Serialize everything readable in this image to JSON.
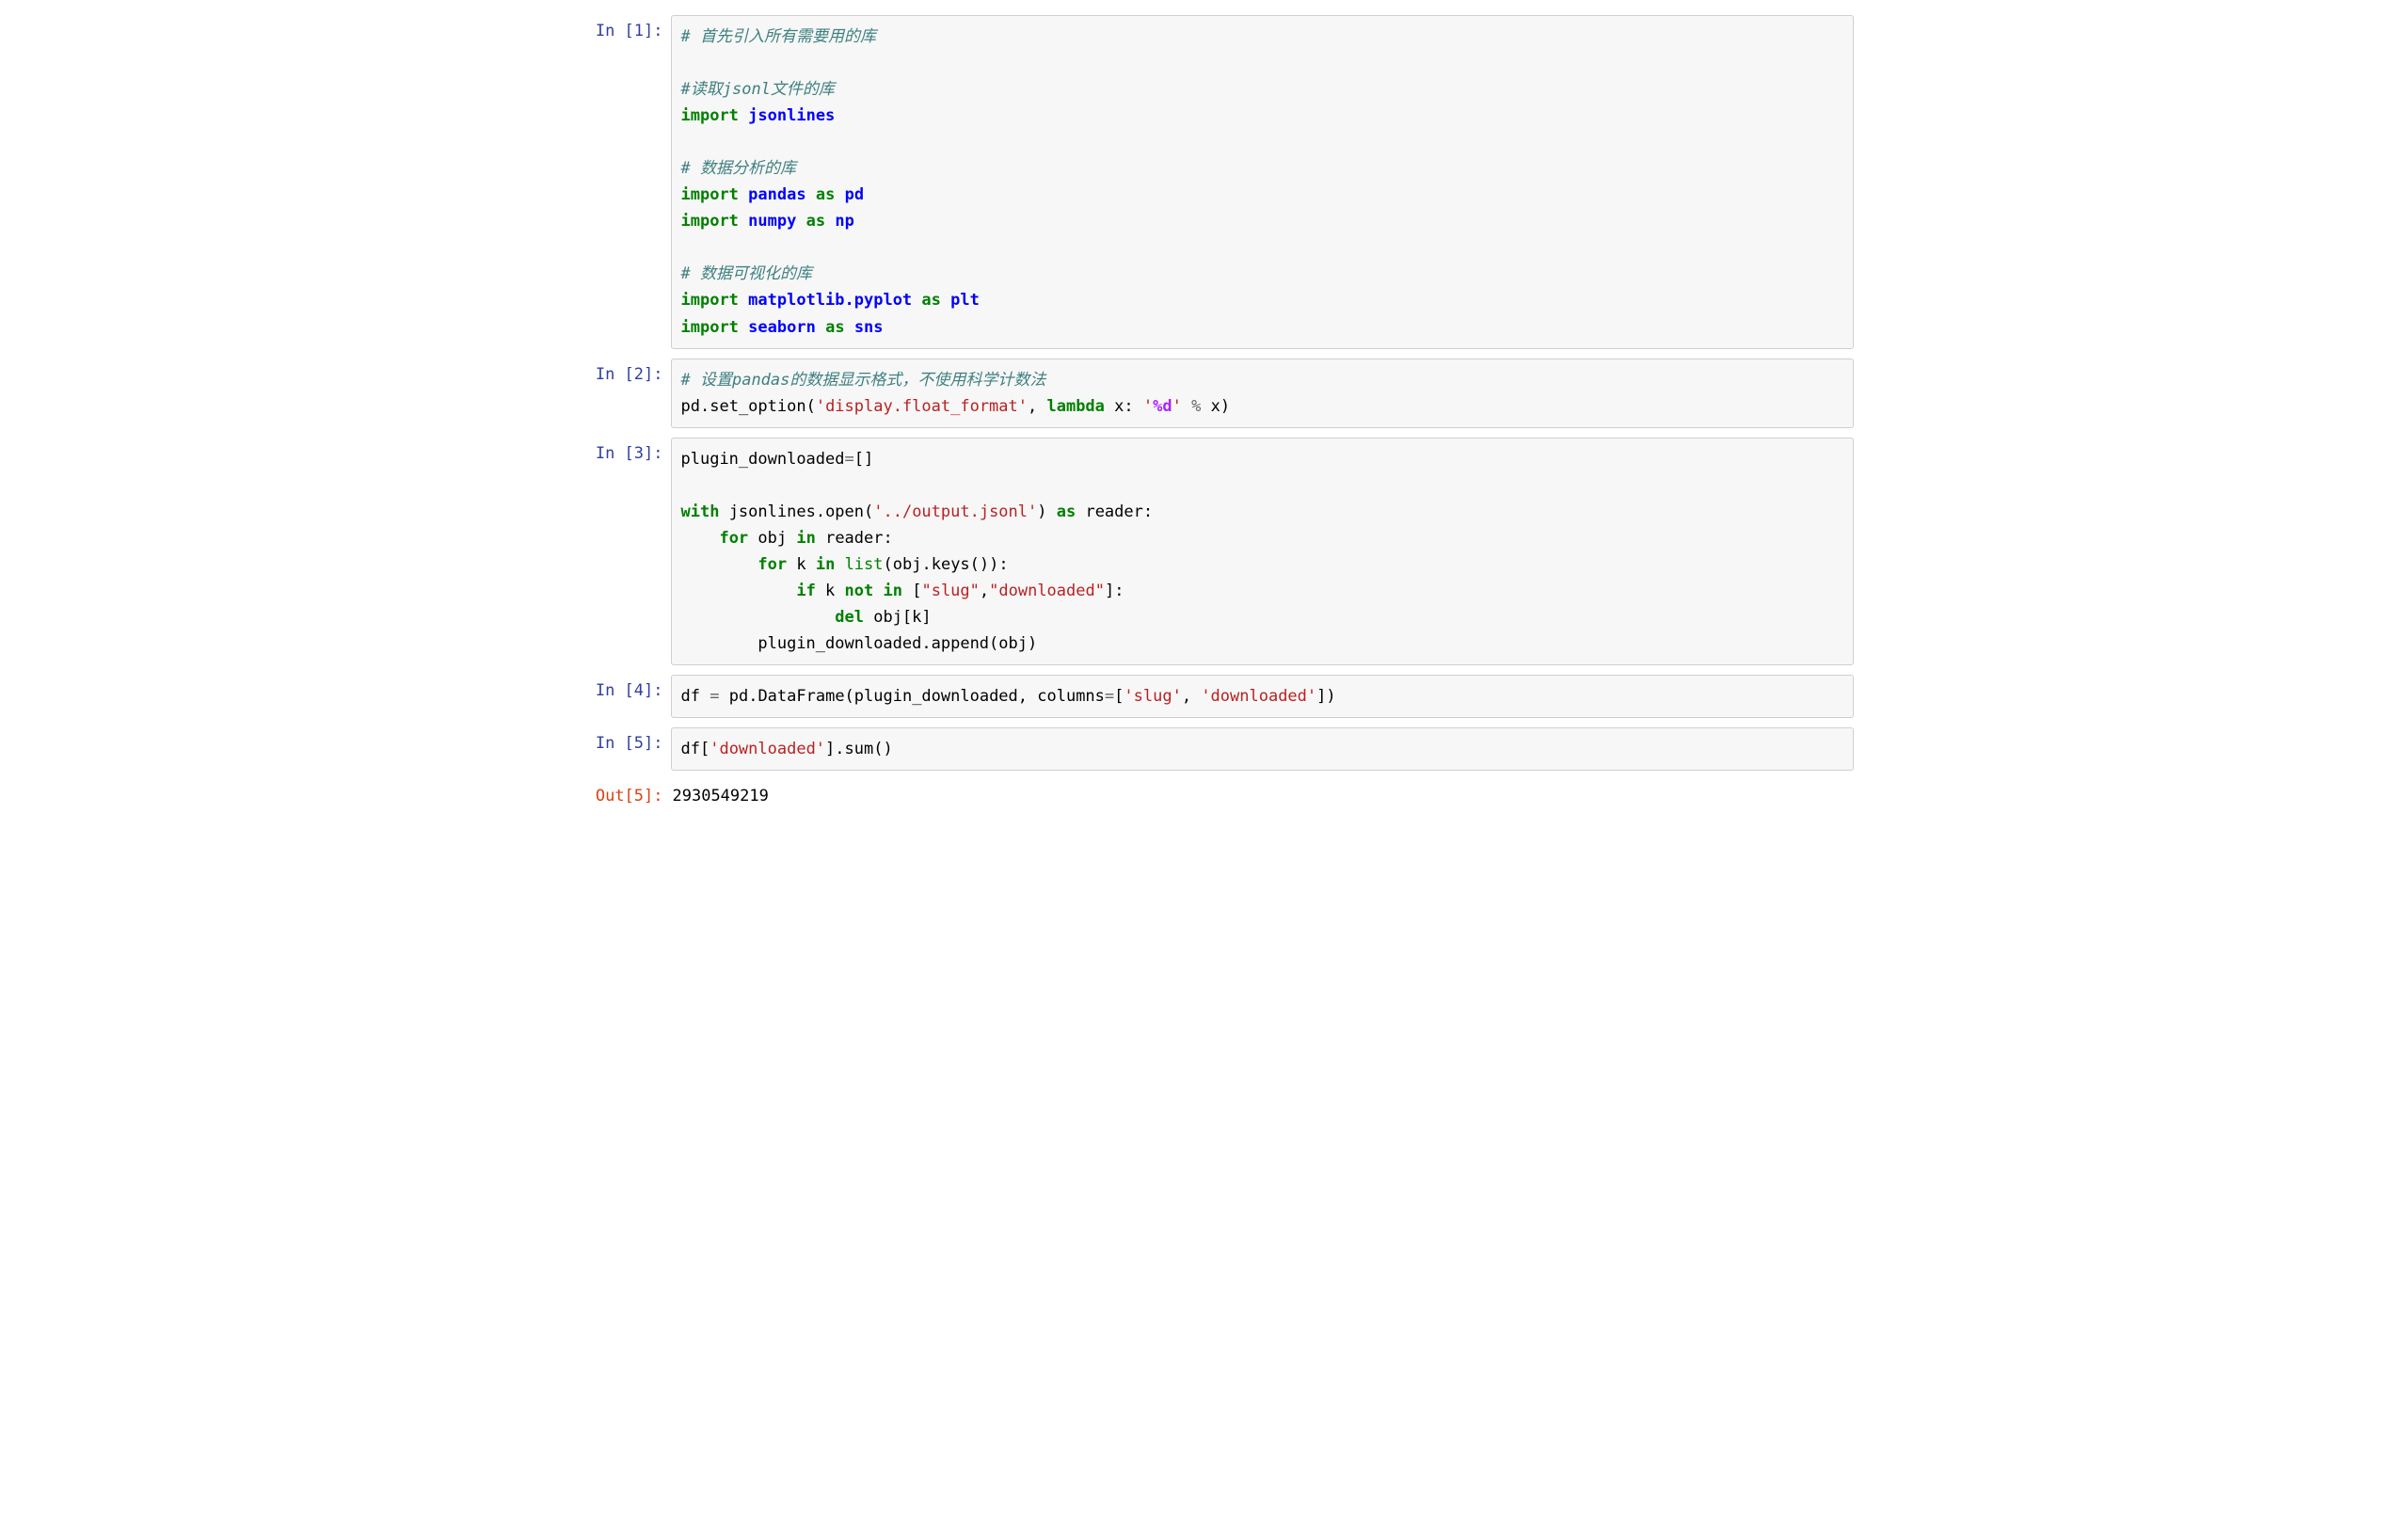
{
  "cells": [
    {
      "prompt_kind": "in",
      "prompt_label": "In [1]:",
      "code_tokens": [
        {
          "t": "# 首先引入所有需要用的库",
          "c": "tok-comment"
        },
        {
          "t": "\n"
        },
        {
          "t": "\n"
        },
        {
          "t": "#读取jsonl文件的库",
          "c": "tok-comment"
        },
        {
          "t": "\n"
        },
        {
          "t": "import",
          "c": "tok-keyword"
        },
        {
          "t": " "
        },
        {
          "t": "jsonlines",
          "c": "tok-module"
        },
        {
          "t": "\n"
        },
        {
          "t": "\n"
        },
        {
          "t": "# 数据分析的库",
          "c": "tok-comment"
        },
        {
          "t": "\n"
        },
        {
          "t": "import",
          "c": "tok-keyword"
        },
        {
          "t": " "
        },
        {
          "t": "pandas",
          "c": "tok-module"
        },
        {
          "t": " "
        },
        {
          "t": "as",
          "c": "tok-keyword"
        },
        {
          "t": " "
        },
        {
          "t": "pd",
          "c": "tok-module"
        },
        {
          "t": "\n"
        },
        {
          "t": "import",
          "c": "tok-keyword"
        },
        {
          "t": " "
        },
        {
          "t": "numpy",
          "c": "tok-module"
        },
        {
          "t": " "
        },
        {
          "t": "as",
          "c": "tok-keyword"
        },
        {
          "t": " "
        },
        {
          "t": "np",
          "c": "tok-module"
        },
        {
          "t": "\n"
        },
        {
          "t": "\n"
        },
        {
          "t": "# 数据可视化的库",
          "c": "tok-comment"
        },
        {
          "t": "\n"
        },
        {
          "t": "import",
          "c": "tok-keyword"
        },
        {
          "t": " "
        },
        {
          "t": "matplotlib.pyplot",
          "c": "tok-module"
        },
        {
          "t": " "
        },
        {
          "t": "as",
          "c": "tok-keyword"
        },
        {
          "t": " "
        },
        {
          "t": "plt",
          "c": "tok-module"
        },
        {
          "t": "\n"
        },
        {
          "t": "import",
          "c": "tok-keyword"
        },
        {
          "t": " "
        },
        {
          "t": "seaborn",
          "c": "tok-module"
        },
        {
          "t": " "
        },
        {
          "t": "as",
          "c": "tok-keyword"
        },
        {
          "t": " "
        },
        {
          "t": "sns",
          "c": "tok-module"
        }
      ]
    },
    {
      "prompt_kind": "in",
      "prompt_label": "In [2]:",
      "code_tokens": [
        {
          "t": "# 设置pandas的数据显示格式，不使用科学计数法",
          "c": "tok-comment"
        },
        {
          "t": "\n"
        },
        {
          "t": "pd"
        },
        {
          "t": "."
        },
        {
          "t": "set_option("
        },
        {
          "t": "'display.float_format'",
          "c": "tok-string"
        },
        {
          "t": ", "
        },
        {
          "t": "lambda",
          "c": "tok-keyword"
        },
        {
          "t": " x: "
        },
        {
          "t": "'",
          "c": "tok-string"
        },
        {
          "t": "%d",
          "c": "tok-purple"
        },
        {
          "t": "'",
          "c": "tok-string"
        },
        {
          "t": " "
        },
        {
          "t": "%",
          "c": "tok-operator"
        },
        {
          "t": " x)"
        }
      ]
    },
    {
      "prompt_kind": "in",
      "prompt_label": "In [3]:",
      "code_tokens": [
        {
          "t": "plugin_downloaded"
        },
        {
          "t": "=",
          "c": "tok-operator"
        },
        {
          "t": "[]"
        },
        {
          "t": "\n"
        },
        {
          "t": "\n"
        },
        {
          "t": "with",
          "c": "tok-keyword"
        },
        {
          "t": " jsonlines"
        },
        {
          "t": "."
        },
        {
          "t": "open("
        },
        {
          "t": "'../output.jsonl'",
          "c": "tok-string"
        },
        {
          "t": ") "
        },
        {
          "t": "as",
          "c": "tok-keyword"
        },
        {
          "t": " reader:"
        },
        {
          "t": "\n"
        },
        {
          "t": "    "
        },
        {
          "t": "for",
          "c": "tok-keyword"
        },
        {
          "t": " obj "
        },
        {
          "t": "in",
          "c": "tok-keyword"
        },
        {
          "t": " reader:"
        },
        {
          "t": "\n"
        },
        {
          "t": "        "
        },
        {
          "t": "for",
          "c": "tok-keyword"
        },
        {
          "t": " k "
        },
        {
          "t": "in",
          "c": "tok-keyword"
        },
        {
          "t": " "
        },
        {
          "t": "list",
          "c": "tok-builtin"
        },
        {
          "t": "(obj"
        },
        {
          "t": "."
        },
        {
          "t": "keys()):"
        },
        {
          "t": "\n"
        },
        {
          "t": "            "
        },
        {
          "t": "if",
          "c": "tok-keyword"
        },
        {
          "t": " k "
        },
        {
          "t": "not",
          "c": "tok-keyword"
        },
        {
          "t": " "
        },
        {
          "t": "in",
          "c": "tok-keyword"
        },
        {
          "t": " ["
        },
        {
          "t": "\"slug\"",
          "c": "tok-string"
        },
        {
          "t": ","
        },
        {
          "t": "\"downloaded\"",
          "c": "tok-string"
        },
        {
          "t": "]:"
        },
        {
          "t": "\n"
        },
        {
          "t": "                "
        },
        {
          "t": "del",
          "c": "tok-keyword"
        },
        {
          "t": " obj[k]"
        },
        {
          "t": "\n"
        },
        {
          "t": "        plugin_downloaded"
        },
        {
          "t": "."
        },
        {
          "t": "append(obj)"
        }
      ]
    },
    {
      "prompt_kind": "in",
      "prompt_label": "In [4]:",
      "code_tokens": [
        {
          "t": "df "
        },
        {
          "t": "=",
          "c": "tok-operator"
        },
        {
          "t": " pd"
        },
        {
          "t": "."
        },
        {
          "t": "DataFrame(plugin_downloaded, columns"
        },
        {
          "t": "=",
          "c": "tok-operator"
        },
        {
          "t": "["
        },
        {
          "t": "'slug'",
          "c": "tok-string"
        },
        {
          "t": ", "
        },
        {
          "t": "'downloaded'",
          "c": "tok-string"
        },
        {
          "t": "])"
        }
      ]
    },
    {
      "prompt_kind": "in",
      "prompt_label": "In [5]:",
      "code_tokens": [
        {
          "t": "df["
        },
        {
          "t": "'downloaded'",
          "c": "tok-string"
        },
        {
          "t": "]"
        },
        {
          "t": "."
        },
        {
          "t": "sum()"
        }
      ]
    },
    {
      "prompt_kind": "out",
      "prompt_label": "Out[5]:",
      "output_text": "2930549219"
    }
  ]
}
